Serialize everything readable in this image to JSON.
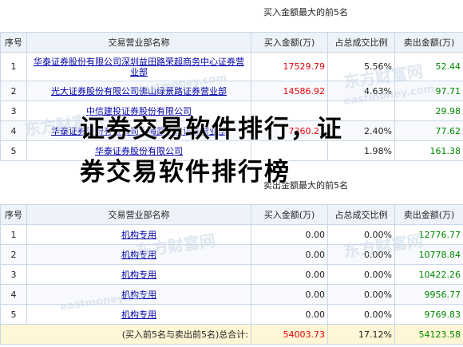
{
  "buy_section": {
    "title": "买入金额最大的前5名",
    "headers": [
      "序号",
      "交易营业部名称",
      "买入金额(万)",
      "占总成交比例",
      "卖出金额(万)"
    ],
    "rows": [
      {
        "no": "1",
        "name": "华泰证券股份有限公司深圳益田路荣超商务中心证券营业部",
        "buy": "17529.79",
        "ratio": "5.56%",
        "sell": "52.44"
      },
      {
        "no": "2",
        "name": "光大证券股份有限公司佛山绿景路证券营业部",
        "buy": "14586.92",
        "ratio": "4.63%",
        "sell": "97.71"
      },
      {
        "no": "3",
        "name": "中信建投证券股份有限公司",
        "buy": "",
        "ratio": "",
        "sell": "29.98"
      },
      {
        "no": "4",
        "name": "华泰证券股份有限公司上海武宁路证券营业部",
        "buy": "7360.21",
        "ratio": "2.40%",
        "sell": "77.62"
      },
      {
        "no": "5",
        "name": "华泰证券股份有限公司",
        "buy": "",
        "ratio": "1.98%",
        "sell": "161.38"
      }
    ]
  },
  "sell_section": {
    "title": "卖出金额最大的前5名",
    "headers": [
      "序号",
      "交易营业部名称",
      "买入金额(万)",
      "占总成交比例",
      "卖出金额(万)"
    ],
    "rows": [
      {
        "no": "1",
        "name": "机构专用",
        "buy": "0.00",
        "ratio": "0.00%",
        "sell": "12776.77"
      },
      {
        "no": "2",
        "name": "机构专用",
        "buy": "0.00",
        "ratio": "0.00%",
        "sell": "10778.84"
      },
      {
        "no": "3",
        "name": "机构专用",
        "buy": "0.00",
        "ratio": "0.00%",
        "sell": "10422.26"
      },
      {
        "no": "4",
        "name": "机构专用",
        "buy": "0.00",
        "ratio": "0.00%",
        "sell": "9956.77"
      },
      {
        "no": "5",
        "name": "机构专用",
        "buy": "0.00",
        "ratio": "0.00%",
        "sell": "9769.83"
      }
    ]
  },
  "total": {
    "label": "(买入前5名与卖出前5名)总合计:",
    "buy": "54003.73",
    "ratio": "17.12%",
    "sell": "54123.58"
  },
  "overlay": {
    "line1": "证券交易软件排行，证",
    "line2": "券交易软件排行榜"
  },
  "watermarks": [
    "东方财富网",
    "eastmoney.com",
    "东方财富网",
    "eastmoney.com",
    "东方财富网",
    "东方财富网",
    "eastmoney.com"
  ],
  "colors": {
    "buy": "#e8000b",
    "sell": "#008800",
    "link": "#0000aa",
    "border": "#c9d7e8",
    "header_bg": "#eef3fa"
  }
}
